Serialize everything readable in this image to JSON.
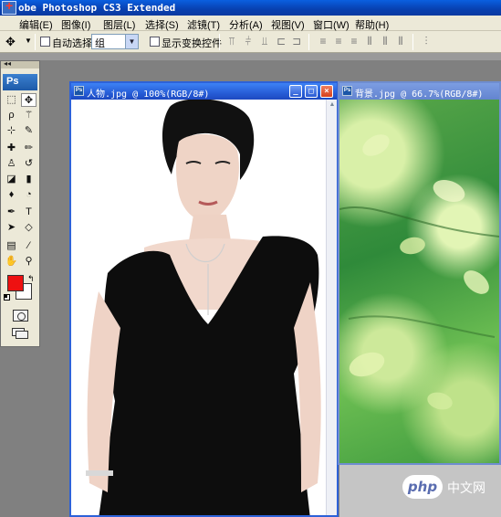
{
  "app": {
    "title": "obe Photoshop CS3 Extended"
  },
  "menu": {
    "items": [
      "编辑(E)",
      "图像(I)",
      "图层(L)",
      "选择(S)",
      "滤镜(T)",
      "分析(A)",
      "视图(V)",
      "窗口(W)",
      "帮助(H)"
    ]
  },
  "options": {
    "auto_select_label": "自动选择:",
    "auto_select_value": "组",
    "show_transform_label": "显示变换控件",
    "tool_icon": "move-tool-icon"
  },
  "toolbox": {
    "logo": "Ps",
    "foreground_color": "#ee1111",
    "background_color": "#ffffff",
    "tools": [
      "marquee",
      "move",
      "lasso",
      "magic-wand",
      "crop",
      "slice",
      "healing",
      "brush",
      "stamp",
      "history-brush",
      "eraser",
      "gradient",
      "blur",
      "dodge",
      "pen",
      "type",
      "path-select",
      "shape",
      "notes",
      "eyedropper",
      "hand",
      "zoom"
    ]
  },
  "documents": [
    {
      "title": "人物.jpg @ 100%(RGB/8#)"
    },
    {
      "title": "背景.jpg @ 66.7%(RGB/8#)"
    }
  ],
  "watermark": {
    "badge": "php",
    "text": "中文网"
  }
}
